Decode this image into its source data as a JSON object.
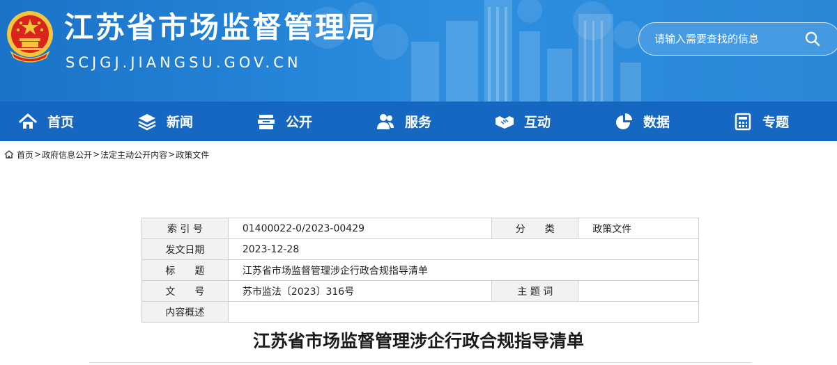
{
  "header": {
    "title": "江苏省市场监督管理局",
    "domain": "SCJGJ.JIANGSU.GOV.CN",
    "emblem_icon": "national-emblem-icon"
  },
  "search": {
    "placeholder": "请输入需要查找的信息",
    "icon": "search-icon"
  },
  "nav": {
    "items": [
      {
        "label": "首页",
        "icon": "home-icon"
      },
      {
        "label": "新闻",
        "icon": "layers-icon"
      },
      {
        "label": "公开",
        "icon": "stack-icon"
      },
      {
        "label": "服务",
        "icon": "users-icon"
      },
      {
        "label": "互动",
        "icon": "handshake-icon"
      },
      {
        "label": "数据",
        "icon": "pie-chart-icon"
      },
      {
        "label": "专题",
        "icon": "calculator-icon"
      }
    ]
  },
  "breadcrumb": {
    "items": [
      "首页",
      "政府信息公开",
      "法定主动公开内容",
      "政策文件"
    ],
    "separator": ">"
  },
  "meta": {
    "index_label": "索 引 号",
    "index_value": "01400022-0/2023-00429",
    "category_label": "分　　类",
    "category_value": "政策文件",
    "date_label": "发文日期",
    "date_value": "2023-12-28",
    "title_label": "标　　题",
    "title_value": "江苏省市场监督管理涉企行政合规指导清单",
    "docno_label": "文　　号",
    "docno_value": "苏市监法〔2023〕316号",
    "keywords_label": "主 题 词",
    "keywords_value": "",
    "summary_label": "内容概述",
    "summary_value": ""
  },
  "article": {
    "title": "江苏省市场监督管理涉企行政合规指导清单"
  },
  "colors": {
    "header_blue": "#2585d8",
    "nav_blue": "#1567c2",
    "emblem_red": "#d8241c",
    "emblem_gold": "#f5c63c"
  }
}
